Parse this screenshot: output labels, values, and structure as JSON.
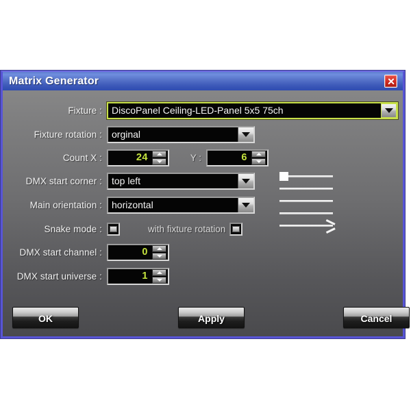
{
  "window": {
    "title": "Matrix Generator",
    "close_icon": "close-icon"
  },
  "form": {
    "fixture": {
      "label": "Fixture :",
      "value": "DiscoPanel Ceiling-LED-Panel 5x5 75ch",
      "focused": true
    },
    "fixture_rotation": {
      "label": "Fixture rotation :",
      "value": "orginal"
    },
    "count": {
      "label_x": "Count X :",
      "value_x": "24",
      "label_y": "Y :",
      "value_y": "6"
    },
    "dmx_start_corner": {
      "label": "DMX start corner :",
      "value": "top left"
    },
    "main_orientation": {
      "label": "Main orientation :",
      "value": "horizontal"
    },
    "snake_mode": {
      "label": "Snake mode :",
      "with_fixture_rotation_label": "with fixture rotation"
    },
    "dmx_start_channel": {
      "label": "DMX start channel :",
      "value": "0"
    },
    "dmx_start_universe": {
      "label": "DMX start universe :",
      "value": "1"
    }
  },
  "preview": {
    "name": "matrix-pattern-preview",
    "rows": 5,
    "start_marker": "square",
    "arrow_on_last_row": true
  },
  "buttons": {
    "ok": "OK",
    "apply": "Apply",
    "cancel": "Cancel"
  },
  "colors": {
    "titlebar_blue": "#3f5cba",
    "border_purple": "#5855d6",
    "value_green": "#c4e23e",
    "focus_border": "#c8e04a",
    "close_red": "#cf2a20",
    "field_black": "#050505"
  }
}
